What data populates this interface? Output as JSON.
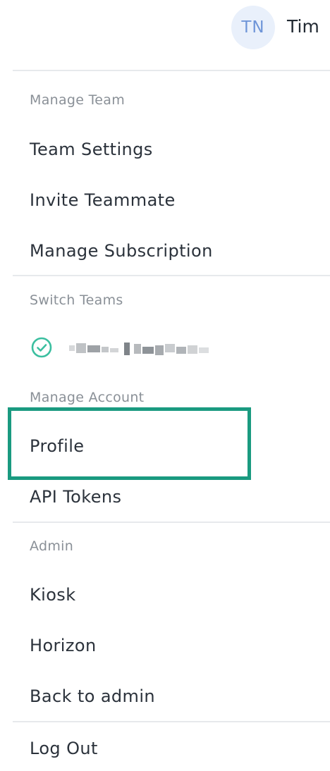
{
  "header": {
    "avatar_initials": "TN",
    "user_name": "Tim"
  },
  "manage_team": {
    "label": "Manage Team",
    "items": [
      "Team Settings",
      "Invite Teammate",
      "Manage Subscription"
    ]
  },
  "switch_teams": {
    "label": "Switch Teams",
    "current_team_icon": "check-circle-icon"
  },
  "manage_account": {
    "label": "Manage Account",
    "items": [
      "Profile",
      "API Tokens"
    ]
  },
  "admin": {
    "label": "Admin",
    "items": [
      "Kiosk",
      "Horizon",
      "Back to admin"
    ]
  },
  "logout": {
    "label": "Log Out"
  },
  "colors": {
    "highlight": "#1a9a80",
    "check": "#3bbfa0",
    "avatar_bg": "#e9f0fb",
    "avatar_text": "#6f95d8"
  }
}
